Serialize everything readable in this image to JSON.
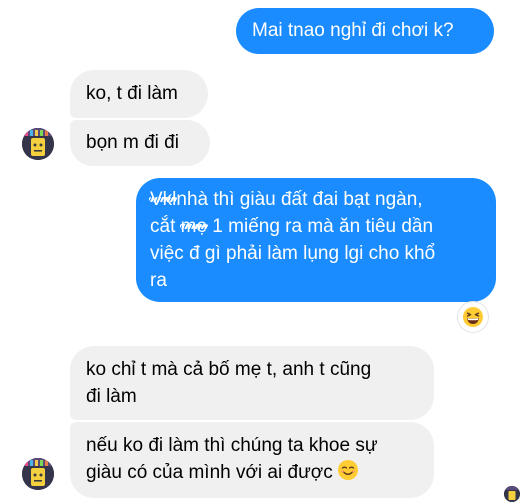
{
  "messages": [
    {
      "from": "me",
      "lines": [
        "Mai tnao nghỉ đi chơi k?"
      ]
    },
    {
      "from": "friend",
      "lines": [
        "ko, t đi làm"
      ]
    },
    {
      "from": "friend",
      "lines": [
        "bọn m đi đi"
      ]
    },
    {
      "from": "me",
      "struck_word_1": "Vkl",
      "line1_rest": "nhà thì giàu đất đai bạt ngàn,",
      "line2_before": "cắt ",
      "struck_word_2": "mẹ",
      "line2_after": " 1 miếng ra mà ăn tiêu dần",
      "line3": "việc đ gì phải làm lụng lgi cho khổ",
      "line4": "ra",
      "reaction": "grinning-squinting-face"
    },
    {
      "from": "friend",
      "lines": [
        "ko chỉ t mà cả bố mẹ t, anh t cũng",
        "đi làm"
      ]
    },
    {
      "from": "friend",
      "lines": [
        "nếu ko đi làm thì chúng ta khoe sự",
        "giàu có của mình với ai được"
      ],
      "emoji": "smiling-face"
    }
  ],
  "colors": {
    "outgoing_bubble": "#1a8cff",
    "incoming_bubble": "#f0f0f0"
  }
}
